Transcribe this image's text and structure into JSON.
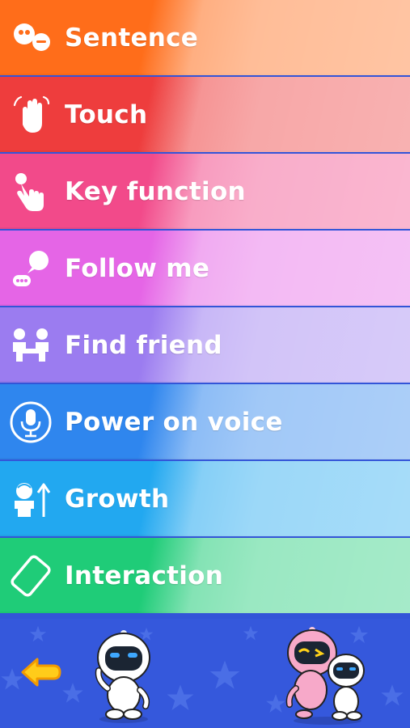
{
  "menu": {
    "items": [
      {
        "label": "Sentence",
        "icon": "sentence-bubbles-icon",
        "color": "#ff6d1a"
      },
      {
        "label": "Touch",
        "icon": "touch-hand-icon",
        "color": "#ee3d3d"
      },
      {
        "label": "Key function",
        "icon": "key-press-finger-icon",
        "color": "#f24a8a"
      },
      {
        "label": "Follow me",
        "icon": "follow-me-chat-icon",
        "color": "#e565e6"
      },
      {
        "label": "Find friend",
        "icon": "find-friend-people-icon",
        "color": "#9b7cf0"
      },
      {
        "label": "Power on voice",
        "icon": "microphone-icon",
        "color": "#2f86ee"
      },
      {
        "label": "Growth",
        "icon": "growth-person-arrow-icon",
        "color": "#22a8f0"
      },
      {
        "label": "Interaction",
        "icon": "phone-interaction-icon",
        "color": "#1fcc78"
      }
    ]
  },
  "footer": {
    "background": "#3558dc",
    "back_icon": "back-arrow-icon",
    "robots": [
      "white-robot-waving",
      "pink-and-white-robots"
    ]
  }
}
